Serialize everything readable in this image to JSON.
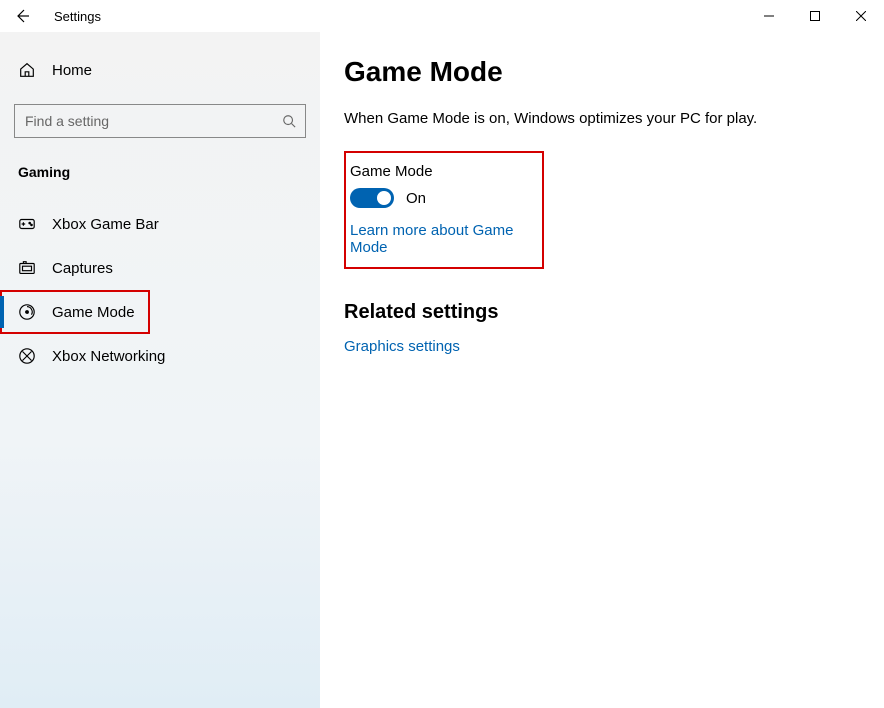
{
  "window": {
    "title": "Settings"
  },
  "sidebar": {
    "home_label": "Home",
    "search_placeholder": "Find a setting",
    "category_label": "Gaming",
    "items": [
      {
        "label": "Xbox Game Bar"
      },
      {
        "label": "Captures"
      },
      {
        "label": "Game Mode"
      },
      {
        "label": "Xbox Networking"
      }
    ]
  },
  "main": {
    "title": "Game Mode",
    "description": "When Game Mode is on, Windows optimizes your PC for play.",
    "toggle_label": "Game Mode",
    "toggle_state": "On",
    "learn_more": "Learn more about Game Mode",
    "related_heading": "Related settings",
    "graphics_link": "Graphics settings"
  }
}
